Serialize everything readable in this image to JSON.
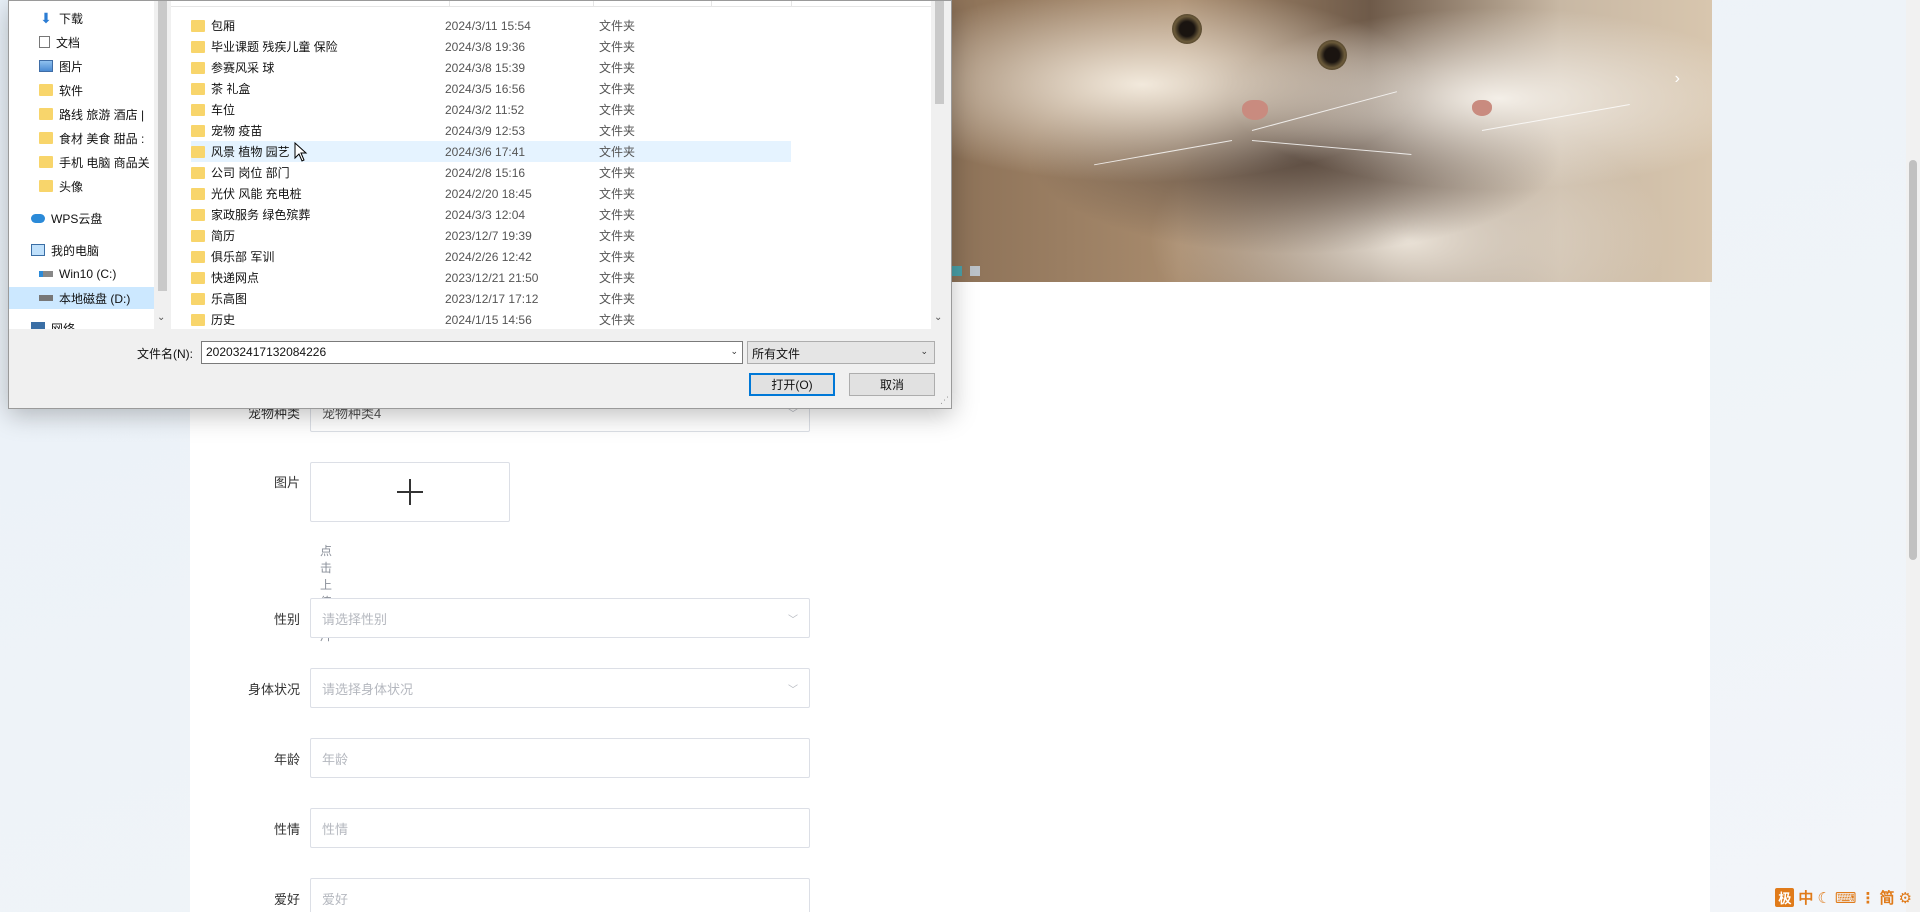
{
  "form": {
    "pet_type": {
      "label": "宠物种类",
      "value": "宠物种类4"
    },
    "image": {
      "label": "图片",
      "hint": "点击上传图片"
    },
    "gender": {
      "label": "性别",
      "placeholder": "请选择性别"
    },
    "health": {
      "label": "身体状况",
      "placeholder": "请选择身体状况"
    },
    "age": {
      "label": "年龄",
      "placeholder": "年龄"
    },
    "temper": {
      "label": "性情",
      "placeholder": "性情"
    },
    "hobby": {
      "label": "爱好",
      "placeholder": "爱好"
    }
  },
  "carousel": {
    "next_icon": "chevron-right-icon"
  },
  "ime": {
    "logo": "极",
    "items": [
      "中",
      "☾",
      "⌨",
      "⋮",
      "简",
      "⚙"
    ]
  },
  "dialog": {
    "nav": [
      {
        "label": "下载",
        "icon": "download-icon",
        "pinned": true
      },
      {
        "label": "文档",
        "icon": "document-icon",
        "pinned": true
      },
      {
        "label": "图片",
        "icon": "picture-icon",
        "pinned": true
      },
      {
        "label": "软件",
        "icon": "folder-icon",
        "pinned": true
      },
      {
        "label": "路线 旅游 酒店 |",
        "icon": "folder-icon",
        "pinned": false
      },
      {
        "label": "食材 美食 甜品 :",
        "icon": "folder-icon",
        "pinned": false
      },
      {
        "label": "手机 电脑 商品关",
        "icon": "folder-icon",
        "pinned": false
      },
      {
        "label": "头像",
        "icon": "folder-icon",
        "pinned": false
      },
      {
        "label": "WPS云盘",
        "icon": "cloud-icon",
        "pinned": false
      },
      {
        "label": "我的电脑",
        "icon": "computer-icon",
        "pinned": false
      },
      {
        "label": "Win10 (C:)",
        "icon": "drive-icon",
        "pinned": false
      },
      {
        "label": "本地磁盘 (D:)",
        "icon": "drive-icon",
        "pinned": false
      },
      {
        "label": "网络",
        "icon": "network-icon",
        "pinned": false
      }
    ],
    "files": [
      {
        "name": "包厢",
        "date": "2024/3/11 15:54",
        "type": "文件夹"
      },
      {
        "name": "毕业课题 残疾儿童 保险",
        "date": "2024/3/8 19:36",
        "type": "文件夹"
      },
      {
        "name": "参赛风采  球",
        "date": "2024/3/8 15:39",
        "type": "文件夹"
      },
      {
        "name": "茶 礼盒",
        "date": "2024/3/5 16:56",
        "type": "文件夹"
      },
      {
        "name": "车位",
        "date": "2024/3/2 11:52",
        "type": "文件夹"
      },
      {
        "name": "宠物  疫苗",
        "date": "2024/3/9 12:53",
        "type": "文件夹"
      },
      {
        "name": "风景 植物 园艺",
        "date": "2024/3/6 17:41",
        "type": "文件夹"
      },
      {
        "name": "公司 岗位 部门",
        "date": "2024/2/8 15:16",
        "type": "文件夹"
      },
      {
        "name": "光伏 风能 充电桩",
        "date": "2024/2/20 18:45",
        "type": "文件夹"
      },
      {
        "name": "家政服务 绿色殡葬",
        "date": "2024/3/3 12:04",
        "type": "文件夹"
      },
      {
        "name": "简历",
        "date": "2023/12/7 19:39",
        "type": "文件夹"
      },
      {
        "name": "俱乐部 军训",
        "date": "2024/2/26 12:42",
        "type": "文件夹"
      },
      {
        "name": "快递网点",
        "date": "2023/12/21 21:50",
        "type": "文件夹"
      },
      {
        "name": "乐高图",
        "date": "2023/12/17 17:12",
        "type": "文件夹"
      },
      {
        "name": "历史",
        "date": "2024/1/15 14:56",
        "type": "文件夹"
      }
    ],
    "filename_label": "文件名(N):",
    "filename_value": "202032417132084226",
    "filetype_value": "所有文件",
    "open_label": "打开(O)",
    "cancel_label": "取消"
  },
  "colors": {
    "accent": "#0078d7",
    "folder": "#f8d56b",
    "hover_row": "#e5f3ff",
    "ime": "#e07b1a"
  }
}
